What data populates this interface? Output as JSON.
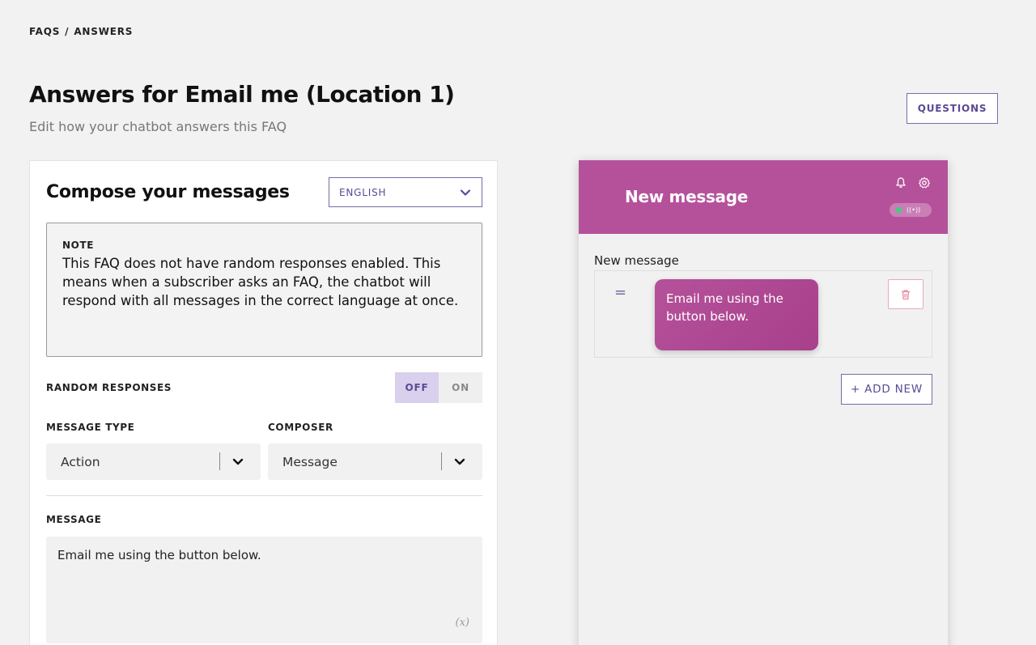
{
  "breadcrumb": {
    "parent": "FAQS",
    "separator": "/",
    "current": "ANSWERS"
  },
  "header": {
    "title": "Answers for Email me (Location 1)",
    "subtitle": "Edit how your chatbot answers this FAQ",
    "questions_button": "QUESTIONS"
  },
  "compose": {
    "title": "Compose your messages",
    "language": {
      "selected": "ENGLISH",
      "icon": "chevron-down-icon"
    },
    "note": {
      "label": "NOTE",
      "text": "This FAQ does not have random responses enabled. This means when a subscriber asks an FAQ, the chatbot will respond with all messages in the correct language at once."
    },
    "random_responses": {
      "label": "RANDOM RESPONSES",
      "off_label": "OFF",
      "on_label": "ON",
      "value": "OFF"
    },
    "message_type": {
      "label": "MESSAGE TYPE",
      "value": "Action"
    },
    "composer": {
      "label": "COMPOSER",
      "value": "Message"
    },
    "message": {
      "label": "MESSAGE",
      "value": "Email me using the button below.",
      "variable_icon": "(x)"
    }
  },
  "preview": {
    "header_title": "New message",
    "icons": [
      "bell-icon",
      "gear-icon"
    ],
    "status": {
      "online_color": "#3fd07a",
      "icon": "broadcast-icon"
    },
    "section_label": "New message",
    "messages": [
      {
        "text": "Email me using the button below."
      }
    ],
    "add_new_label": "+ ADD NEW"
  },
  "colors": {
    "brand": "#b5519a",
    "accent": "#5b4a94",
    "background": "#f2f2f2"
  }
}
